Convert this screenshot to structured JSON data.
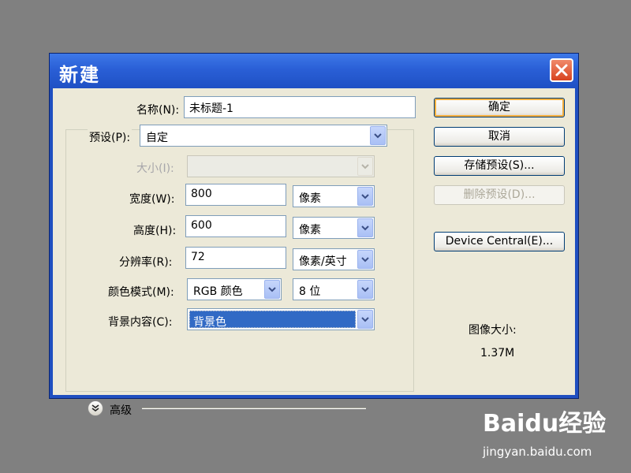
{
  "window": {
    "title": "新建"
  },
  "form": {
    "name": {
      "label": "名称(N):",
      "value": "未标题-1"
    },
    "preset": {
      "label": "预设(P):",
      "value": "自定"
    },
    "size": {
      "label": "大小(I):",
      "value": ""
    },
    "width": {
      "label": "宽度(W):",
      "value": "800",
      "unit": "像素"
    },
    "height": {
      "label": "高度(H):",
      "value": "600",
      "unit": "像素"
    },
    "resolution": {
      "label": "分辨率(R):",
      "value": "72",
      "unit": "像素/英寸"
    },
    "color_mode": {
      "label": "颜色模式(M):",
      "value": "RGB 颜色",
      "depth": "8 位"
    },
    "background": {
      "label": "背景内容(C):",
      "value": "背景色"
    },
    "advanced": {
      "label": "高级"
    }
  },
  "buttons": {
    "ok": "确定",
    "cancel": "取消",
    "save_preset": "存储预设(S)...",
    "delete_preset": "删除预设(D)...",
    "device_central": "Device Central(E)..."
  },
  "image_size": {
    "label": "图像大小:",
    "value": "1.37M"
  },
  "watermark": {
    "logo": "Baidu经验",
    "url": "jingyan.baidu.com"
  },
  "colors": {
    "title_bar": "#2a5fd6",
    "dialog_bg": "#ece9d8",
    "selection": "#316ac5",
    "close_button": "#d8431f"
  }
}
